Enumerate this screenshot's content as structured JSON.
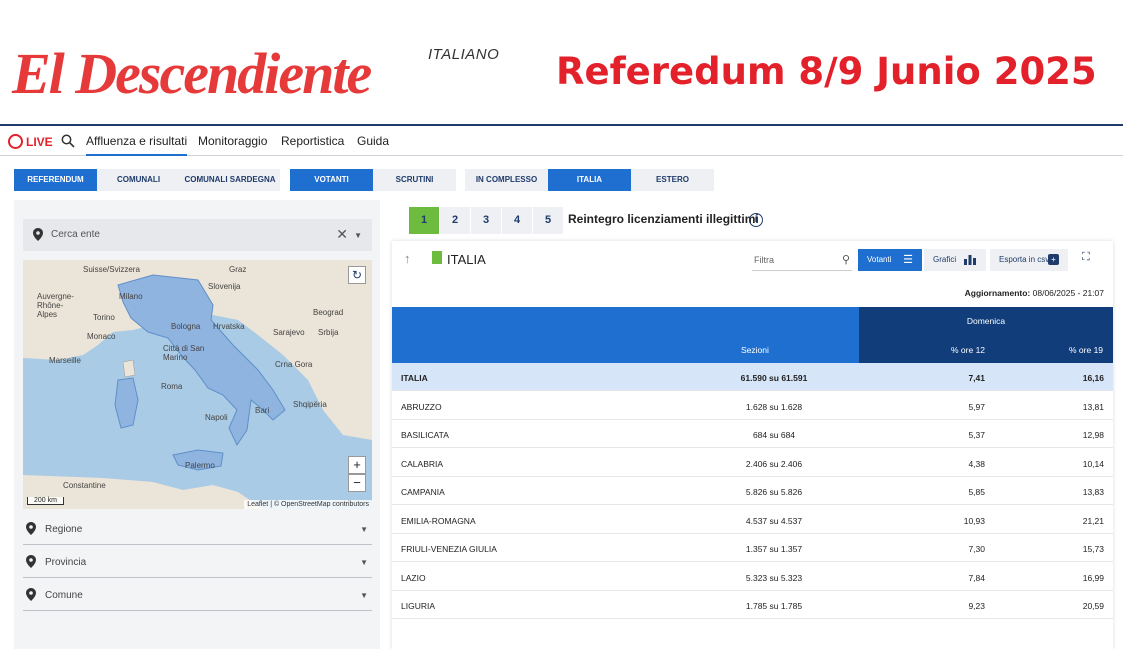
{
  "banner": {
    "brand": "El Descendiente",
    "brand_sub": "ITALIANO",
    "headline": "Referedum 8/9 Junio 2025"
  },
  "topnav": {
    "live": "LIVE",
    "items": [
      "Affluenza e risultati",
      "Monitoraggio",
      "Reportistica",
      "Guida"
    ]
  },
  "filters": {
    "group1": [
      "REFERENDUM",
      "COMUNALI",
      "COMUNALI SARDEGNA"
    ],
    "group2": [
      "VOTANTI",
      "SCRUTINI"
    ],
    "group3": [
      "IN COMPLESSO",
      "ITALIA",
      "ESTERO"
    ]
  },
  "left": {
    "search_placeholder": "Cerca ente",
    "selects": [
      "Regione",
      "Provincia",
      "Comune"
    ],
    "map_labels": [
      "Suisse/Svizzera",
      "Graz",
      "Auvergne-Rhône-Alpes",
      "Milano",
      "Torino",
      "Slovenija",
      "Hrvatska",
      "Beograd",
      "Monaco",
      "Bologna",
      "Sarajevo",
      "Srbija",
      "Marseille",
      "Città di San Marino",
      "Crna Gora",
      "Roma",
      "Shqipëria",
      "Bari",
      "Napoli",
      "Palermo",
      "Constantine"
    ],
    "scale": "200 km",
    "attribution": "Leaflet | © OpenStreetMap contributors"
  },
  "right": {
    "question_tabs": [
      "1",
      "2",
      "3",
      "4",
      "5"
    ],
    "question_title": "Reintegro licenziamenti illegittimi",
    "card_title": "ITALIA",
    "filter_placeholder": "Filtra",
    "btn_votanti": "Votanti",
    "btn_grafici": "Grafici",
    "btn_csv": "Esporta in csv",
    "update_label": "Aggiornamento:",
    "update_value": "08/06/2025 - 21:07",
    "group_header": "Domenica",
    "col_sezioni": "Sezioni",
    "col_ore12": "% ore 12",
    "col_ore19": "% ore 19",
    "rows": [
      {
        "name": "ITALIA",
        "sezioni": "61.590 su 61.591",
        "ore12": "7,41",
        "ore19": "16,16"
      },
      {
        "name": "ABRUZZO",
        "sezioni": "1.628 su 1.628",
        "ore12": "5,97",
        "ore19": "13,81"
      },
      {
        "name": "BASILICATA",
        "sezioni": "684 su 684",
        "ore12": "5,37",
        "ore19": "12,98"
      },
      {
        "name": "CALABRIA",
        "sezioni": "2.406 su 2.406",
        "ore12": "4,38",
        "ore19": "10,14"
      },
      {
        "name": "CAMPANIA",
        "sezioni": "5.826 su 5.826",
        "ore12": "5,85",
        "ore19": "13,83"
      },
      {
        "name": "EMILIA-ROMAGNA",
        "sezioni": "4.537 su 4.537",
        "ore12": "10,93",
        "ore19": "21,21"
      },
      {
        "name": "FRIULI-VENEZIA GIULIA",
        "sezioni": "1.357 su 1.357",
        "ore12": "7,30",
        "ore19": "15,73"
      },
      {
        "name": "LAZIO",
        "sezioni": "5.323 su 5.323",
        "ore12": "7,84",
        "ore19": "16,99"
      },
      {
        "name": "LIGURIA",
        "sezioni": "1.785 su 1.785",
        "ore12": "9,23",
        "ore19": "20,59"
      }
    ]
  },
  "colors": {
    "brand_red": "#e3212a",
    "primary_blue": "#1f6fd0",
    "dark_blue": "#113e7a",
    "active_green": "#6dbb3f"
  }
}
